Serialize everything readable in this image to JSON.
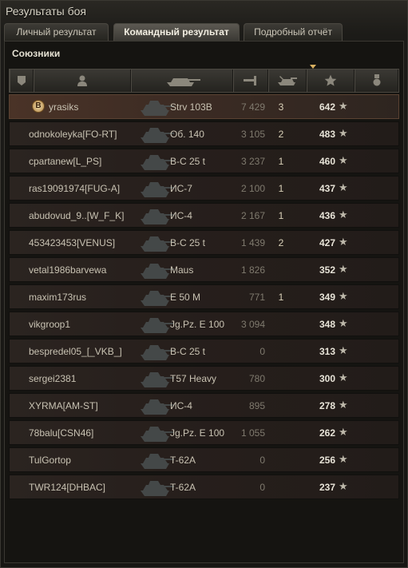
{
  "window": {
    "title": "Результаты боя"
  },
  "tabs": [
    {
      "label": "Личный результат"
    },
    {
      "label": "Командный результат"
    },
    {
      "label": "Подробный отчёт"
    }
  ],
  "section": {
    "title": "Союзники"
  },
  "header": {
    "icons": [
      "platoon-icon",
      "player-icon",
      "tank-icon",
      "damage-icon",
      "kills-icon",
      "xp-star-icon",
      "medal-icon"
    ]
  },
  "rows": [
    {
      "player": "yrasiks",
      "vehicle": "Strv 103B",
      "damage": "7 429",
      "kills": "3",
      "xp": "642",
      "self": true,
      "badge": "B"
    },
    {
      "player": "odnokoleyka[FO-RT]",
      "vehicle": "Об. 140",
      "damage": "3 105",
      "kills": "2",
      "xp": "483"
    },
    {
      "player": "cpartanew[L_PS]",
      "vehicle": "В-С 25 t",
      "damage": "3 237",
      "kills": "1",
      "xp": "460"
    },
    {
      "player": "ras19091974[FUG-A]",
      "vehicle": "ИС-7",
      "damage": "2 100",
      "kills": "1",
      "xp": "437"
    },
    {
      "player": "abudovud_9..[W_F_K]",
      "vehicle": "ИС-4",
      "damage": "2 167",
      "kills": "1",
      "xp": "436"
    },
    {
      "player": "453423453[VENUS]",
      "vehicle": "В-С 25 t",
      "damage": "1 439",
      "kills": "2",
      "xp": "427"
    },
    {
      "player": "vetal1986barvewa",
      "vehicle": "Maus",
      "damage": "1 826",
      "kills": "",
      "xp": "352"
    },
    {
      "player": "maxim173rus",
      "vehicle": "E 50 M",
      "damage": "771",
      "kills": "1",
      "xp": "349"
    },
    {
      "player": "vikgroop1",
      "vehicle": "Jg.Pz. E 100",
      "damage": "3 094",
      "kills": "",
      "xp": "348"
    },
    {
      "player": "bespredel05_[_VKB_]",
      "vehicle": "В-С 25 t",
      "damage": "0",
      "kills": "",
      "xp": "313"
    },
    {
      "player": "sergei2381",
      "vehicle": "T57 Heavy",
      "damage": "780",
      "kills": "",
      "xp": "300"
    },
    {
      "player": "XYRMA[AM-ST]",
      "vehicle": "ИС-4",
      "damage": "895",
      "kills": "",
      "xp": "278"
    },
    {
      "player": "78balu[CSN46]",
      "vehicle": "Jg.Pz. E 100",
      "damage": "1 055",
      "kills": "",
      "xp": "262"
    },
    {
      "player": "TulGortop",
      "vehicle": "T-62A",
      "damage": "0",
      "kills": "",
      "xp": "256"
    },
    {
      "player": "TWR124[DHBAC]",
      "vehicle": "T-62A",
      "damage": "0",
      "kills": "",
      "xp": "237"
    }
  ],
  "star_glyph": "★"
}
